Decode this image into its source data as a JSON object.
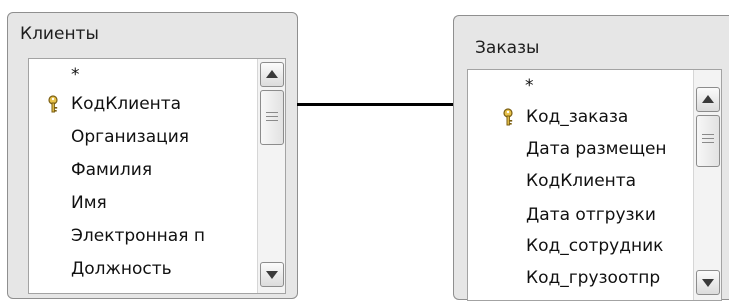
{
  "tables": [
    {
      "title": "Клиенты",
      "fields": [
        {
          "name": "*",
          "is_key": false
        },
        {
          "name": "КодКлиента",
          "is_key": true
        },
        {
          "name": "Организация",
          "is_key": false
        },
        {
          "name": "Фамилия",
          "is_key": false
        },
        {
          "name": "Имя",
          "is_key": false
        },
        {
          "name": "Электронная п",
          "is_key": false
        },
        {
          "name": "Должность",
          "is_key": false
        }
      ]
    },
    {
      "title": "Заказы",
      "fields": [
        {
          "name": "*",
          "is_key": false
        },
        {
          "name": "Код_заказа",
          "is_key": true
        },
        {
          "name": "Дата размещен",
          "is_key": false
        },
        {
          "name": "КодКлиента",
          "is_key": false
        },
        {
          "name": "Дата отгрузки",
          "is_key": false
        },
        {
          "name": "Код_сотрудник",
          "is_key": false
        },
        {
          "name": "Код_грузоотпр",
          "is_key": false
        }
      ]
    }
  ],
  "icons": {
    "primary_key": "key-icon",
    "scroll_up": "arrow-up-icon",
    "scroll_down": "arrow-down-icon"
  },
  "colors": {
    "key_fill": "#e8c24a",
    "relation_line": "#000000"
  }
}
